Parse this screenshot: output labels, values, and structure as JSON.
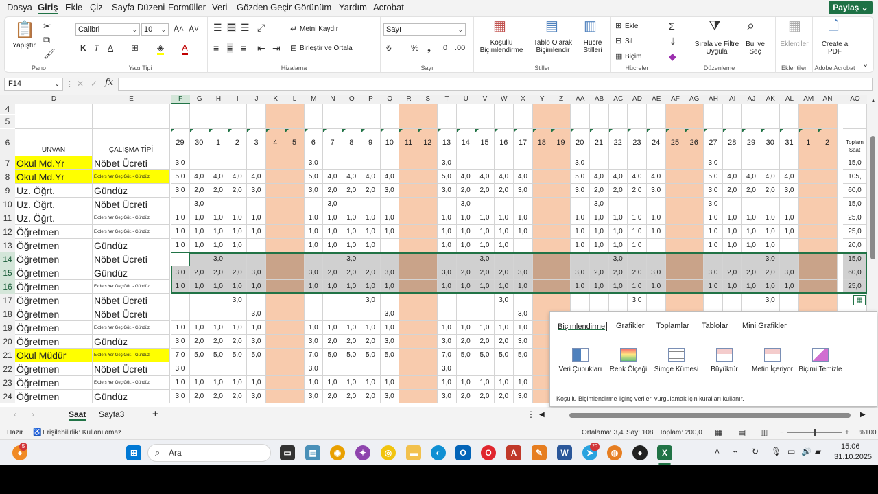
{
  "menu": {
    "items": [
      "Dosya",
      "Giriş",
      "Ekle",
      "Çiz",
      "Sayfa Düzeni",
      "Formüller",
      "Veri",
      "Gözden Geçir",
      "Görünüm",
      "Yardım",
      "Acrobat"
    ],
    "share": "Paylaş"
  },
  "ribbon": {
    "pano": {
      "label": "Pano",
      "paste": "Yapıştır"
    },
    "font": {
      "label": "Yazı Tipi",
      "name": "Calibri",
      "size": "10",
      "bold": "K",
      "italic": "T",
      "underline": "A"
    },
    "align": {
      "label": "Hizalama",
      "wrap": "Metni Kaydır",
      "merge": "Birleştir ve Ortala"
    },
    "number": {
      "label": "Sayı",
      "format": "Sayı"
    },
    "styles": {
      "label": "Stiller",
      "cond": "Koşullu Biçimlendirme",
      "table": "Tablo Olarak Biçimlendir",
      "cell": "Hücre Stilleri"
    },
    "cells": {
      "label": "Hücreler",
      "insert": "Ekle",
      "delete": "Sil",
      "format": "Biçim"
    },
    "edit": {
      "label": "Düzenleme",
      "sort": "Sırala ve Filtre Uygula",
      "find": "Bul ve Seç"
    },
    "addins": {
      "label": "Eklentiler",
      "btn": "Eklentiler"
    },
    "acrobat": {
      "label": "Adobe Acrobat",
      "btn": "Create a PDF"
    }
  },
  "formula": {
    "namebox": "F14",
    "fx": "fx"
  },
  "columns": [
    "D",
    "E",
    "F",
    "G",
    "H",
    "I",
    "J",
    "K",
    "L",
    "M",
    "N",
    "O",
    "P",
    "Q",
    "R",
    "S",
    "T",
    "U",
    "V",
    "W",
    "X",
    "Y",
    "Z",
    "AA",
    "AB",
    "AC",
    "AD",
    "AE",
    "AF",
    "AG",
    "AH",
    "AI",
    "AJ",
    "AK",
    "AL",
    "AM",
    "AN",
    "AO"
  ],
  "day_headers": [
    "29",
    "30",
    "1",
    "2",
    "3",
    "4",
    "5",
    "6",
    "7",
    "8",
    "9",
    "10",
    "11",
    "12",
    "13",
    "14",
    "15",
    "16",
    "17",
    "18",
    "19",
    "20",
    "21",
    "22",
    "23",
    "24",
    "25",
    "26",
    "27",
    "28",
    "29",
    "30",
    "31",
    "1",
    "2"
  ],
  "weekend_idx": [
    5,
    6,
    12,
    13,
    19,
    20,
    26,
    27,
    33,
    34
  ],
  "header": {
    "unvan": "UNVAN",
    "tip": "ÇALIŞMA TİPİ",
    "total": "Toplam Saat"
  },
  "rows": [
    {
      "n": "7",
      "unvan": "Okul Md.Yr",
      "tip": "Nöbet Ücreti",
      "yellow": true,
      "vals": [
        "3,0",
        "",
        "",
        "",
        "",
        "",
        "",
        "3,0",
        "",
        "",
        "",
        "",
        "",
        "",
        "3,0",
        "",
        "",
        "",
        "",
        "",
        "",
        "3,0",
        "",
        "",
        "",
        "",
        "",
        "",
        "3,0",
        "",
        "",
        "",
        "",
        "",
        ""
      ],
      "total": "15,0"
    },
    {
      "n": "8",
      "unvan": "Okul Md.Yr",
      "tip": "Ekders Yer Geç Gör. - Gündüz",
      "yellow": true,
      "small": true,
      "vals": [
        "5,0",
        "4,0",
        "4,0",
        "4,0",
        "4,0",
        "",
        "",
        "5,0",
        "4,0",
        "4,0",
        "4,0",
        "4,0",
        "",
        "",
        "5,0",
        "4,0",
        "4,0",
        "4,0",
        "4,0",
        "",
        "",
        "5,0",
        "4,0",
        "4,0",
        "4,0",
        "4,0",
        "",
        "",
        "5,0",
        "4,0",
        "4,0",
        "4,0",
        "4,0",
        "",
        ""
      ],
      "total": "105,"
    },
    {
      "n": "9",
      "unvan": "Uz. Öğrt.",
      "tip": "Gündüz",
      "vals": [
        "3,0",
        "2,0",
        "2,0",
        "2,0",
        "3,0",
        "",
        "",
        "3,0",
        "2,0",
        "2,0",
        "2,0",
        "3,0",
        "",
        "",
        "3,0",
        "2,0",
        "2,0",
        "2,0",
        "3,0",
        "",
        "",
        "3,0",
        "2,0",
        "2,0",
        "2,0",
        "3,0",
        "",
        "",
        "3,0",
        "2,0",
        "2,0",
        "2,0",
        "3,0",
        "",
        ""
      ],
      "total": "60,0"
    },
    {
      "n": "10",
      "unvan": "Uz. Öğrt.",
      "tip": "Nöbet Ücreti",
      "vals": [
        "",
        "3,0",
        "",
        "",
        "",
        "",
        "",
        "",
        "3,0",
        "",
        "",
        "",
        "",
        "",
        "",
        "3,0",
        "",
        "",
        "",
        "",
        "",
        "",
        "3,0",
        "",
        "",
        "",
        "",
        "",
        "3,0",
        "",
        "",
        "",
        "",
        "",
        ""
      ],
      "total": "15,0"
    },
    {
      "n": "11",
      "unvan": "Uz. Öğrt.",
      "tip": "Ekders Yer Geç Gör. - Gündüz",
      "small": true,
      "vals": [
        "1,0",
        "1,0",
        "1,0",
        "1,0",
        "1,0",
        "",
        "",
        "1,0",
        "1,0",
        "1,0",
        "1,0",
        "1,0",
        "",
        "",
        "1,0",
        "1,0",
        "1,0",
        "1,0",
        "1,0",
        "",
        "",
        "1,0",
        "1,0",
        "1,0",
        "1,0",
        "1,0",
        "",
        "",
        "1,0",
        "1,0",
        "1,0",
        "1,0",
        "1,0",
        "",
        ""
      ],
      "total": "25,0"
    },
    {
      "n": "12",
      "unvan": "Öğretmen",
      "tip": "Ekders Yer Geç Gör. - Gündüz",
      "small": true,
      "vals": [
        "1,0",
        "1,0",
        "1,0",
        "1,0",
        "1,0",
        "",
        "",
        "1,0",
        "1,0",
        "1,0",
        "1,0",
        "1,0",
        "",
        "",
        "1,0",
        "1,0",
        "1,0",
        "1,0",
        "1,0",
        "",
        "",
        "1,0",
        "1,0",
        "1,0",
        "1,0",
        "1,0",
        "",
        "",
        "1,0",
        "1,0",
        "1,0",
        "1,0",
        "1,0",
        "",
        ""
      ],
      "total": "25,0"
    },
    {
      "n": "13",
      "unvan": "Öğretmen",
      "tip": "Gündüz",
      "vals": [
        "1,0",
        "1,0",
        "1,0",
        "1,0",
        "",
        "",
        "",
        "1,0",
        "1,0",
        "1,0",
        "1,0",
        "",
        "",
        "",
        "1,0",
        "1,0",
        "1,0",
        "1,0",
        "",
        "",
        "",
        "1,0",
        "1,0",
        "1,0",
        "1,0",
        "",
        "",
        "",
        "1,0",
        "1,0",
        "1,0",
        "1,0",
        "",
        "",
        ""
      ],
      "total": "20,0"
    },
    {
      "n": "14",
      "unvan": "Öğretmen",
      "tip": "Nöbet Ücreti",
      "sel": true,
      "vals": [
        "",
        "",
        "3,0",
        "",
        "",
        "",
        "",
        "",
        "",
        "3,0",
        "",
        "",
        "",
        "",
        "",
        "",
        "3,0",
        "",
        "",
        "",
        "",
        "",
        "",
        "3,0",
        "",
        "",
        "",
        "",
        "",
        "",
        "",
        "3,0",
        "",
        "",
        ""
      ],
      "total": "15,0"
    },
    {
      "n": "15",
      "unvan": "Öğretmen",
      "tip": "Gündüz",
      "sel": true,
      "vals": [
        "3,0",
        "2,0",
        "2,0",
        "2,0",
        "3,0",
        "",
        "",
        "3,0",
        "2,0",
        "2,0",
        "2,0",
        "3,0",
        "",
        "",
        "3,0",
        "2,0",
        "2,0",
        "2,0",
        "3,0",
        "",
        "",
        "3,0",
        "2,0",
        "2,0",
        "2,0",
        "3,0",
        "",
        "",
        "3,0",
        "2,0",
        "2,0",
        "2,0",
        "3,0",
        "",
        ""
      ],
      "total": "60,0"
    },
    {
      "n": "16",
      "unvan": "Öğretmen",
      "tip": "Ekders Yer Geç Gör. - Gündüz",
      "small": true,
      "sel": true,
      "vals": [
        "1,0",
        "1,0",
        "1,0",
        "1,0",
        "1,0",
        "",
        "",
        "1,0",
        "1,0",
        "1,0",
        "1,0",
        "1,0",
        "",
        "",
        "1,0",
        "1,0",
        "1,0",
        "1,0",
        "1,0",
        "",
        "",
        "1,0",
        "1,0",
        "1,0",
        "1,0",
        "1,0",
        "",
        "",
        "1,0",
        "1,0",
        "1,0",
        "1,0",
        "1,0",
        "",
        ""
      ],
      "total": "25,0"
    },
    {
      "n": "17",
      "unvan": "Öğretmen",
      "tip": "Nöbet Ücreti",
      "vals": [
        "",
        "",
        "",
        "3,0",
        "",
        "",
        "",
        "",
        "",
        "",
        "3,0",
        "",
        "",
        "",
        "",
        "",
        "",
        "3,0",
        "",
        "",
        "",
        "",
        "",
        "",
        "3,0",
        "",
        "",
        "",
        "",
        "",
        "",
        "3,0",
        "",
        "",
        ""
      ],
      "total": ""
    },
    {
      "n": "18",
      "unvan": "Öğretmen",
      "tip": "Nöbet Ücreti",
      "vals": [
        "",
        "",
        "",
        "",
        "3,0",
        "",
        "",
        "",
        "",
        "",
        "",
        "3,0",
        "",
        "",
        "",
        "",
        "",
        "",
        "3,0",
        "",
        "",
        "",
        "",
        "",
        "",
        "",
        "",
        "",
        "",
        "",
        "",
        "",
        "",
        "",
        ""
      ],
      "total": ""
    },
    {
      "n": "19",
      "unvan": "Öğretmen",
      "tip": "Ekders Yer Geç Gör. - Gündüz",
      "small": true,
      "vals": [
        "1,0",
        "1,0",
        "1,0",
        "1,0",
        "1,0",
        "",
        "",
        "1,0",
        "1,0",
        "1,0",
        "1,0",
        "1,0",
        "",
        "",
        "1,0",
        "1,0",
        "1,0",
        "1,0",
        "1,0",
        "",
        "",
        "",
        "",
        "",
        "",
        "",
        "",
        "",
        "",
        "",
        "",
        "",
        "",
        "",
        ""
      ],
      "total": ""
    },
    {
      "n": "20",
      "unvan": "Öğretmen",
      "tip": "Gündüz",
      "vals": [
        "3,0",
        "2,0",
        "2,0",
        "2,0",
        "3,0",
        "",
        "",
        "3,0",
        "2,0",
        "2,0",
        "2,0",
        "3,0",
        "",
        "",
        "3,0",
        "2,0",
        "2,0",
        "2,0",
        "3,0",
        "",
        "",
        "",
        "",
        "",
        "",
        "",
        "",
        "",
        "",
        "",
        "",
        "",
        "",
        "",
        ""
      ],
      "total": ""
    },
    {
      "n": "21",
      "unvan": "Okul Müdür",
      "tip": "Ekders Yer Geç Gör. - Gündüz",
      "yellow": true,
      "small": true,
      "vals": [
        "7,0",
        "5,0",
        "5,0",
        "5,0",
        "5,0",
        "",
        "",
        "7,0",
        "5,0",
        "5,0",
        "5,0",
        "5,0",
        "",
        "",
        "7,0",
        "5,0",
        "5,0",
        "5,0",
        "5,0",
        "",
        "",
        "",
        "",
        "",
        "",
        "",
        "",
        "",
        "",
        "",
        "",
        "",
        "",
        "",
        ""
      ],
      "total": ""
    },
    {
      "n": "22",
      "unvan": "Öğretmen",
      "tip": "Nöbet Ücreti",
      "vals": [
        "3,0",
        "",
        "",
        "",
        "",
        "",
        "",
        "3,0",
        "",
        "",
        "",
        "",
        "",
        "",
        "3,0",
        "",
        "",
        "",
        "",
        "",
        "",
        "",
        "",
        "",
        "",
        "",
        "",
        "",
        "",
        "",
        "",
        "",
        "",
        "",
        ""
      ],
      "total": ""
    },
    {
      "n": "23",
      "unvan": "Öğretmen",
      "tip": "Ekders Yer Geç Gör. - Gündüz",
      "small": true,
      "vals": [
        "1,0",
        "1,0",
        "1,0",
        "1,0",
        "1,0",
        "",
        "",
        "1,0",
        "1,0",
        "1,0",
        "1,0",
        "1,0",
        "",
        "",
        "1,0",
        "1,0",
        "1,0",
        "1,0",
        "1,0",
        "",
        "",
        "",
        "",
        "",
        "",
        "",
        "",
        "",
        "",
        "",
        "",
        "",
        "",
        "",
        ""
      ],
      "total": ""
    },
    {
      "n": "24",
      "unvan": "Öğretmen",
      "tip": "Gündüz",
      "vals": [
        "3,0",
        "2,0",
        "2,0",
        "2,0",
        "3,0",
        "",
        "",
        "3,0",
        "2,0",
        "2,0",
        "2,0",
        "3,0",
        "",
        "",
        "3,0",
        "2,0",
        "2,0",
        "2,0",
        "3,0",
        "",
        "",
        "",
        "",
        "",
        "",
        "",
        "",
        "",
        "",
        "",
        "",
        "",
        "",
        "",
        ""
      ],
      "total": ""
    }
  ],
  "quick_analysis": {
    "tabs": [
      "Biçimlendirme",
      "Grafikler",
      "Toplamlar",
      "Tablolar",
      "Mini Grafikler"
    ],
    "options": [
      "Veri Çubukları",
      "Renk Ölçeği",
      "Simge Kümesi",
      "Büyüktür",
      "Metin İçeriyor",
      "Biçimi Temizle"
    ],
    "hint": "Koşullu Biçimlendirme ilginç verileri vurgulamak için kuralları kullanır."
  },
  "sheets": [
    "Saat",
    "Sayfa3"
  ],
  "status": {
    "ready": "Hazır",
    "access": "Erişilebilirlik: Kullanılamaz",
    "avg": "Ortalama: 3,4",
    "count": "Say: 108",
    "sum": "Toplam: 200,0",
    "zoom": "%100"
  },
  "taskbar": {
    "search": "Ara",
    "time": "15:06",
    "date": "31.10.2025",
    "badge": "5",
    "badge2": "20"
  },
  "colors": {
    "weekend": "#f8cbad",
    "yellow": "#ffff00",
    "accent": "#217346",
    "sel": "#d0d0d0"
  }
}
